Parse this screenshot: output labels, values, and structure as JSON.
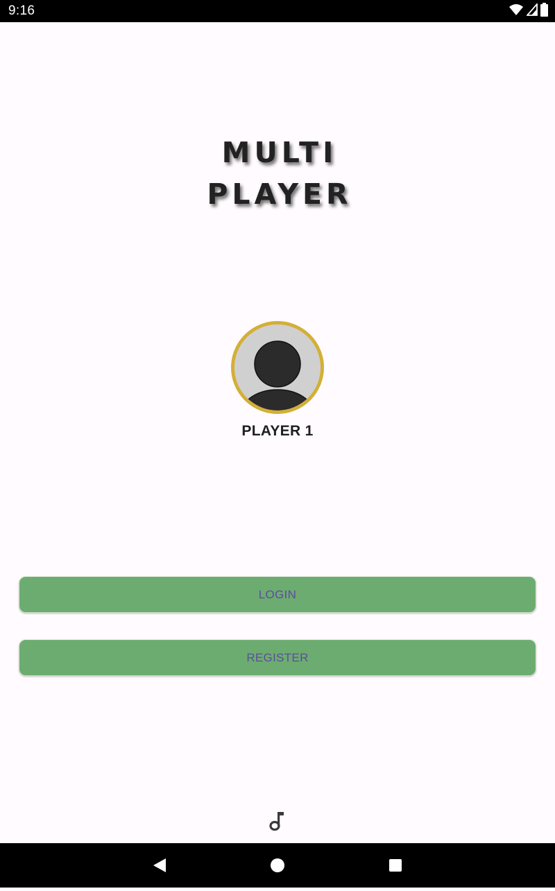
{
  "status_bar": {
    "time": "9:16",
    "icons": [
      "wifi-icon",
      "signal-icon",
      "battery-icon"
    ]
  },
  "title": {
    "line1": "MULTI",
    "line2": "PLAYER"
  },
  "player": {
    "name": "PLAYER 1",
    "avatar_icon": "person-avatar-icon",
    "ring_color": "#d4af37"
  },
  "buttons": {
    "login_label": "LOGIN",
    "register_label": "REGISTER",
    "background_color": "#6dac71",
    "text_color": "#5b4d9c"
  },
  "footer": {
    "music_icon": "music-note-icon"
  },
  "nav_bar": {
    "icons": [
      "back-icon",
      "home-icon",
      "recents-icon"
    ]
  }
}
